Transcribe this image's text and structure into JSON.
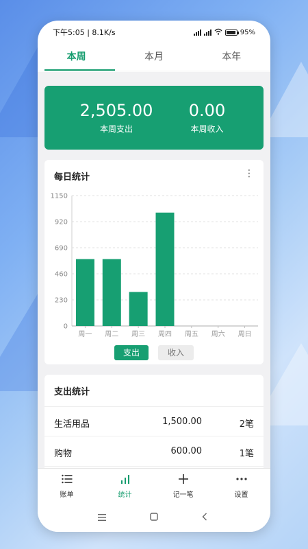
{
  "status_bar": {
    "time": "下午5:05 | 8.1K/s",
    "battery": "95"
  },
  "tabs": [
    "本周",
    "本月",
    "本年"
  ],
  "summary": {
    "expense_value": "2,505.00",
    "expense_label": "本周支出",
    "income_value": "0.00",
    "income_label": "本周收入"
  },
  "daily_card": {
    "title": "每日统计",
    "toggle_expense": "支出",
    "toggle_income": "收入"
  },
  "chart_data": {
    "type": "bar",
    "categories": [
      "周一",
      "周二",
      "周三",
      "周四",
      "周五",
      "周六",
      "周日"
    ],
    "values": [
      590,
      590,
      300,
      1000,
      0,
      0,
      0
    ],
    "yticks": [
      "0",
      "230",
      "460",
      "690",
      "920",
      "1150"
    ],
    "ylim": [
      0,
      1150
    ],
    "grid": true,
    "color": "#179f72"
  },
  "expense_card": {
    "title": "支出统计",
    "rows": [
      {
        "name": "生活用品",
        "amount": "1,500.00",
        "count": "2笔"
      },
      {
        "name": "购物",
        "amount": "600.00",
        "count": "1笔"
      }
    ]
  },
  "bottom_nav": {
    "items": [
      {
        "label": "账单",
        "icon": "list-icon"
      },
      {
        "label": "统计",
        "icon": "bar-chart-icon"
      },
      {
        "label": "记一笔",
        "icon": "plus-icon"
      },
      {
        "label": "设置",
        "icon": "more-dots-icon"
      }
    ]
  },
  "colors": {
    "accent": "#179f72"
  }
}
